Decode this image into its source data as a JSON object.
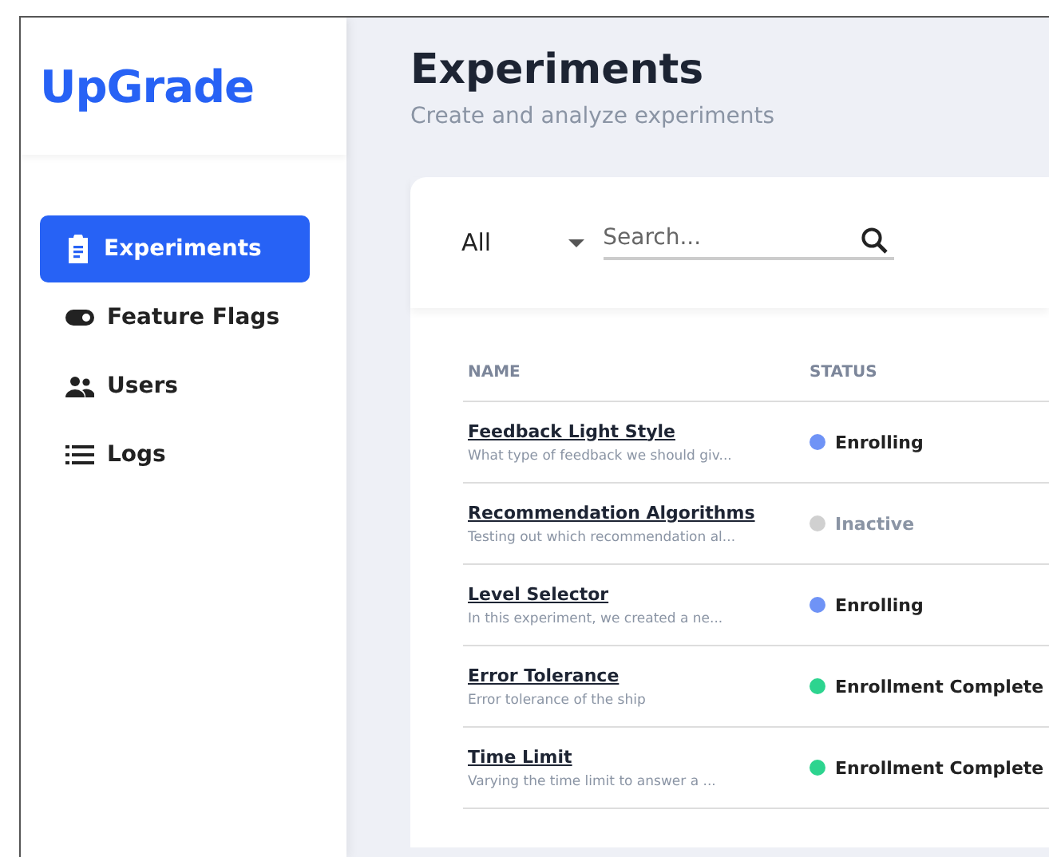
{
  "logo": "UpGrade",
  "nav": [
    {
      "label": "Experiments",
      "kind": "clipboard",
      "selected": true
    },
    {
      "label": "Feature Flags",
      "kind": "toggle",
      "selected": false
    },
    {
      "label": "Users",
      "kind": "users",
      "selected": false
    },
    {
      "label": "Logs",
      "kind": "list",
      "selected": false
    }
  ],
  "page": {
    "title": "Experiments",
    "subtitle": "Create and analyze experiments"
  },
  "filter": {
    "value": "All",
    "search_placeholder": "Search..."
  },
  "table": {
    "columns": [
      "NAME",
      "STATUS"
    ],
    "rows": [
      {
        "name": "Feedback Light Style",
        "description": "What type of feedback we should giv...",
        "status": "Enrolling",
        "color": "#6f93f6",
        "muted": false
      },
      {
        "name": "Recommendation Algorithms",
        "description": "Testing out which recommendation al...",
        "status": "Inactive",
        "color": "#d0d0d0",
        "muted": true
      },
      {
        "name": "Level Selector",
        "description": "In this experiment, we created a ne...",
        "status": "Enrolling",
        "color": "#6f93f6",
        "muted": false
      },
      {
        "name": "Error Tolerance",
        "description": "Error tolerance of the ship",
        "status": "Enrollment Complete",
        "color": "#2dd48f",
        "muted": false
      },
      {
        "name": "Time Limit",
        "description": "Varying the time limit to answer a ...",
        "status": "Enrollment Complete",
        "color": "#2dd48f",
        "muted": false
      }
    ]
  }
}
